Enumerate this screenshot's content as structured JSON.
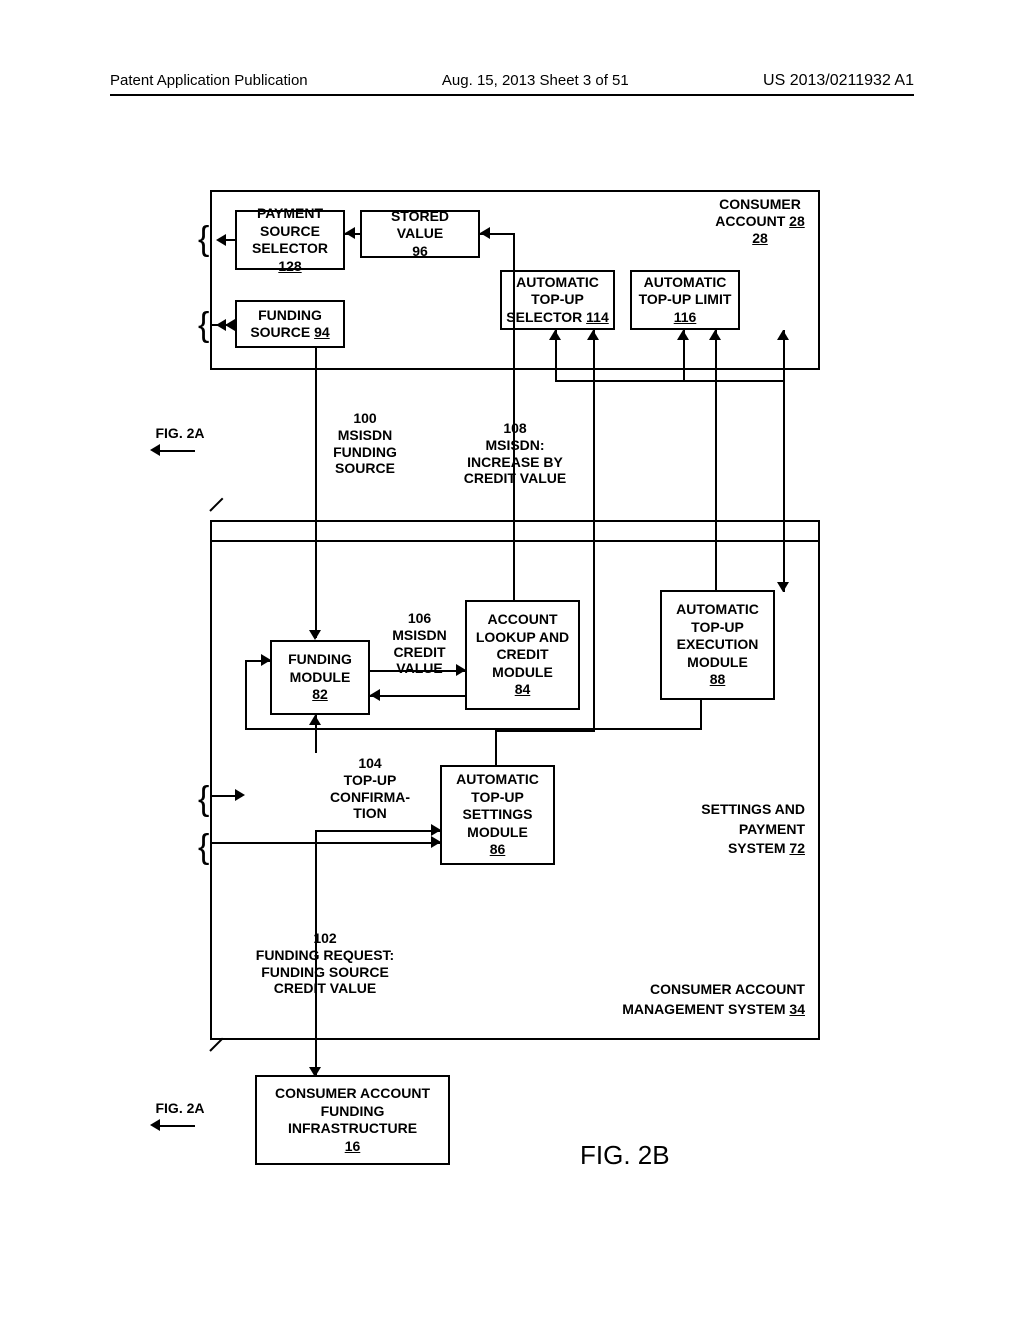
{
  "header": {
    "left": "Patent Application Publication",
    "center": "Aug. 15, 2013  Sheet 3 of 51",
    "right": "US 2013/0211932 A1"
  },
  "figure_label": "FIG. 2B",
  "crossref_a": "FIG. 2A",
  "crossref_b": "FIG. 2A",
  "outer_top": {
    "title": "CONSUMER ACCOUNT",
    "ref": "28"
  },
  "boxes": {
    "payment_source_selector": {
      "l1": "PAYMENT",
      "l2": "SOURCE",
      "l3": "SELECTOR",
      "ref": "128"
    },
    "funding_source": {
      "l1": "FUNDING",
      "l2": "SOURCE",
      "ref": "94"
    },
    "stored_value": {
      "l1": "STORED VALUE",
      "ref": "96"
    },
    "auto_topup_selector": {
      "l1": "AUTOMATIC",
      "l2": "TOP-UP",
      "l3": "SELECTOR",
      "ref": "114"
    },
    "auto_topup_limit": {
      "l1": "AUTOMATIC",
      "l2": "TOP-UP LIMIT",
      "ref": "116"
    },
    "funding_module": {
      "l1": "FUNDING",
      "l2": "MODULE",
      "ref": "82"
    },
    "lookup_module": {
      "l1": "ACCOUNT",
      "l2": "LOOKUP AND",
      "l3": "CREDIT",
      "l4": "MODULE",
      "ref": "84"
    },
    "exec_module": {
      "l1": "AUTOMATIC",
      "l2": "TOP-UP",
      "l3": "EXECUTION",
      "l4": "MODULE",
      "ref": "88"
    },
    "settings_module": {
      "l1": "AUTOMATIC",
      "l2": "TOP-UP",
      "l3": "SETTINGS",
      "l4": "MODULE",
      "ref": "86"
    },
    "infra": {
      "l1": "CONSUMER ACCOUNT",
      "l2": "FUNDING",
      "l3": "INFRASTRUCTURE",
      "ref": "16"
    }
  },
  "flow_labels": {
    "f100": {
      "num": "100",
      "l1": "MSISDN",
      "l2": "FUNDING",
      "l3": "SOURCE"
    },
    "f108": {
      "num": "108",
      "l1": "MSISDN:",
      "l2": "INCREASE BY",
      "l3": "CREDIT VALUE"
    },
    "f106": {
      "num": "106",
      "l1": "MSISDN",
      "l2": "CREDIT",
      "l3": "VALUE"
    },
    "f104": {
      "num": "104",
      "l1": "TOP-UP",
      "l2": "CONFIRMA-",
      "l3": "TION"
    },
    "f102": {
      "num": "102",
      "l1": "FUNDING REQUEST:",
      "l2": "FUNDING SOURCE",
      "l3": "CREDIT VALUE"
    }
  },
  "bottom_labels": {
    "settings_payment": {
      "l1": "SETTINGS AND",
      "l2": "PAYMENT",
      "l3": "SYSTEM",
      "ref": "72"
    },
    "cams": {
      "l1": "CONSUMER ACCOUNT",
      "l2": "MANAGEMENT SYSTEM",
      "ref": "34"
    }
  }
}
